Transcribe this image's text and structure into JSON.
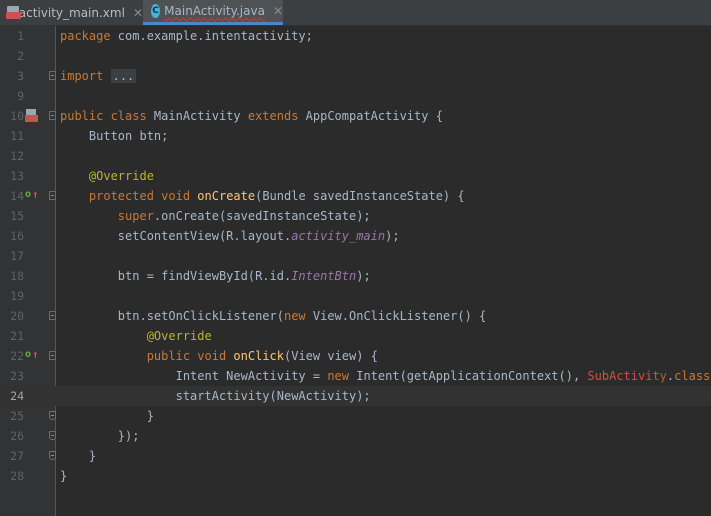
{
  "tabs": [
    {
      "label": "activity_main.xml",
      "icon": "xml-file-icon",
      "active": false
    },
    {
      "label": "MainActivity.java",
      "icon": "java-class-icon",
      "active": true
    }
  ],
  "colors": {
    "background": "#2b2b2b",
    "gutter": "#313335",
    "keyword": "#cc7832",
    "annotation": "#bbb529",
    "method": "#ffc66d",
    "field": "#9876aa",
    "text": "#a9b7c6",
    "tab_accent": "#4a88c7"
  },
  "editor": {
    "current_line": 24,
    "lines": [
      {
        "n": "1",
        "t": [
          {
            "k": "kw",
            "s": "package"
          },
          {
            "k": "p",
            "s": " com.example.intentactivity;"
          }
        ]
      },
      {
        "n": "2",
        "t": []
      },
      {
        "n": "3",
        "t": [
          {
            "k": "kw",
            "s": "import"
          },
          {
            "k": "p",
            "s": " "
          },
          {
            "k": "fold",
            "s": "..."
          }
        ]
      },
      {
        "n": "9",
        "t": []
      },
      {
        "n": "10",
        "t": [
          {
            "k": "kw",
            "s": "public class"
          },
          {
            "k": "p",
            "s": " MainActivity "
          },
          {
            "k": "kw",
            "s": "extends"
          },
          {
            "k": "p",
            "s": " AppCompatActivity {"
          }
        ]
      },
      {
        "n": "11",
        "t": [
          {
            "k": "p",
            "s": "    Button btn;"
          }
        ]
      },
      {
        "n": "12",
        "t": []
      },
      {
        "n": "13",
        "t": [
          {
            "k": "p",
            "s": "    "
          },
          {
            "k": "ann",
            "s": "@Override"
          }
        ]
      },
      {
        "n": "14",
        "t": [
          {
            "k": "p",
            "s": "    "
          },
          {
            "k": "kw",
            "s": "protected void"
          },
          {
            "k": "p",
            "s": " "
          },
          {
            "k": "fn",
            "s": "onCreate"
          },
          {
            "k": "p",
            "s": "(Bundle savedInstanceState) {"
          }
        ]
      },
      {
        "n": "15",
        "t": [
          {
            "k": "p",
            "s": "        "
          },
          {
            "k": "kw",
            "s": "super"
          },
          {
            "k": "p",
            "s": ".onCreate(savedInstanceState);"
          }
        ]
      },
      {
        "n": "16",
        "t": [
          {
            "k": "p",
            "s": "        setContentView(R.layout."
          },
          {
            "k": "fld",
            "s": "activity_main"
          },
          {
            "k": "p",
            "s": ");"
          }
        ]
      },
      {
        "n": "17",
        "t": []
      },
      {
        "n": "18",
        "t": [
          {
            "k": "p",
            "s": "        btn = findViewById(R.id."
          },
          {
            "k": "fld",
            "s": "IntentBtn"
          },
          {
            "k": "p",
            "s": ");"
          }
        ]
      },
      {
        "n": "19",
        "t": []
      },
      {
        "n": "20",
        "t": [
          {
            "k": "p",
            "s": "        btn.setOnClickListener("
          },
          {
            "k": "kw",
            "s": "new"
          },
          {
            "k": "p",
            "s": " View.OnClickListener() {"
          }
        ]
      },
      {
        "n": "21",
        "t": [
          {
            "k": "p",
            "s": "            "
          },
          {
            "k": "ann",
            "s": "@Override"
          }
        ]
      },
      {
        "n": "22",
        "t": [
          {
            "k": "p",
            "s": "            "
          },
          {
            "k": "kw",
            "s": "public void"
          },
          {
            "k": "p",
            "s": " "
          },
          {
            "k": "fn",
            "s": "onClick"
          },
          {
            "k": "p",
            "s": "(View view) {"
          }
        ]
      },
      {
        "n": "23",
        "t": [
          {
            "k": "p",
            "s": "                Intent NewActivity = "
          },
          {
            "k": "kw",
            "s": "new"
          },
          {
            "k": "p",
            "s": " Intent(getApplicationContext(), "
          },
          {
            "k": "sub",
            "s": "SubActivity"
          },
          {
            "k": "p",
            "s": "."
          },
          {
            "k": "kw",
            "s": "class"
          },
          {
            "k": "p",
            "s": ");"
          }
        ]
      },
      {
        "n": "24",
        "t": [
          {
            "k": "p",
            "s": "                startActivity(NewActivity);"
          }
        ]
      },
      {
        "n": "25",
        "t": [
          {
            "k": "p",
            "s": "            }"
          }
        ]
      },
      {
        "n": "26",
        "t": [
          {
            "k": "p",
            "s": "        });"
          }
        ]
      },
      {
        "n": "27",
        "t": [
          {
            "k": "p",
            "s": "    }"
          }
        ]
      },
      {
        "n": "28",
        "t": [
          {
            "k": "p",
            "s": "}"
          }
        ]
      }
    ]
  }
}
